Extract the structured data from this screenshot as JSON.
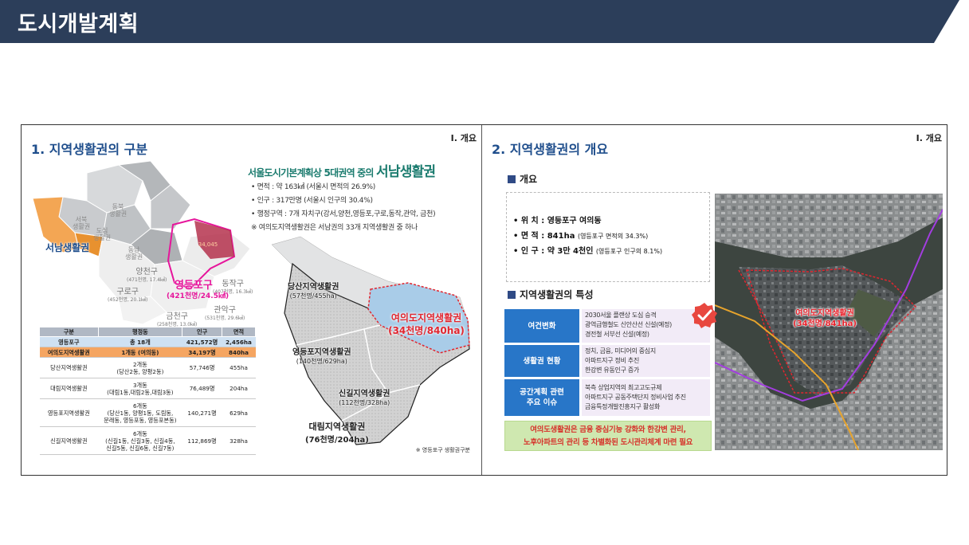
{
  "header": {
    "title": "도시개발계획",
    "color": "#2c3e5a"
  },
  "left_panel": {
    "title": "1. 지역생활권의 구분",
    "section_tag": "Ⅰ. 개요",
    "map_labels": {
      "seonam": "서남생활권",
      "yeongdeungpo": "영등포구",
      "yeongdeungpo_sub": "(421천명/24.5㎢)",
      "yangcheon": "양천구",
      "yangcheon_sub": "(471천명, 17.4㎢)",
      "guro": "구로구",
      "guro_sub": "(452천명, 20.1㎢)",
      "dongjak": "동작구",
      "dongjak_sub": "(407천명, 16.3㎢)",
      "gwanak": "관악구",
      "gwanak_sub": "(531천명, 29.6㎢)",
      "geumcheon": "금천구",
      "geumcheon_sub": "(258천명, 13.0㎢)",
      "dongbuk": "동북\n생활권",
      "seobuk": "서북\n생활권",
      "dosim": "도심\n생활권",
      "dongnam": "동남\n생활권"
    },
    "spatial_title_prefix": "서울도시기본계획상 5대권역 중의 ",
    "spatial_title_big": "서남생활권",
    "bullets": [
      "• 면적 : 약 163㎢ (서울시 면적의 26.9%)",
      "• 인구 : 317만명 (서울시 인구의 30.4%)",
      "• 행정구역 : 7개 자치구(강서,양천,영등포,구로,동작,관악, 금천)",
      "※  여의도지역생활권은 서남권의 33개 지역생활권 중 하나"
    ],
    "table": {
      "headers": [
        "구분",
        "행정동",
        "인구",
        "면적"
      ],
      "rows": [
        {
          "cls": "r-total",
          "cells": [
            "영등포구",
            "총 18개",
            "421,572명",
            "2,456ha"
          ]
        },
        {
          "cls": "r-ydo",
          "cells": [
            "여의도지역생활권",
            "1개동 (여의동)",
            "34,197명",
            "840ha"
          ]
        },
        {
          "cls": "",
          "cells": [
            "당산지역생활권",
            "2개동\n(당산2동, 양평2동)",
            "57,746명",
            "455ha"
          ]
        },
        {
          "cls": "",
          "cells": [
            "대림지역생활권",
            "3개동\n(대림1동,대림2동,대림3동)",
            "76,489명",
            "204ha"
          ]
        },
        {
          "cls": "",
          "cells": [
            "영등포지역생활권",
            "6개동\n(당산1동, 양평1동, 도림동,\n문래동, 영등포동, 영등포본동)",
            "140,271명",
            "629ha"
          ]
        },
        {
          "cls": "",
          "cells": [
            "신길지역생활권",
            "6개동\n(신길1동, 신길3동, 신길4동,\n신길5동, 신길6동, 신길7동)",
            "112,869명",
            "328ha"
          ]
        }
      ]
    },
    "district_labels": {
      "dangsan": "당산지역생활권",
      "dangsan_sub": "(57천명/455ha)",
      "yeouido": "여의도지역생활권",
      "yeouido_sub": "(34천명/840ha)",
      "ydp": "영등포지역생활권",
      "ydp_sub": "(140천명/629ha)",
      "singil": "신길지역생활권",
      "singil_sub": "(112천명/328ha)",
      "daerim": "대림지역생활권",
      "daerim_sub": "(76천명/204ha)"
    },
    "footnote": "※ 영등포구 생활권구분"
  },
  "right_panel": {
    "title": "2. 지역생활권의 개요",
    "section_tag": "Ⅰ. 개요",
    "overview_head": "개요",
    "overview": [
      {
        "main": "• 위  치 : 영등포구 여의동",
        "small": ""
      },
      {
        "main": "• 면  적 : 841ha ",
        "small": "(영등포구 면적의 34.3%)"
      },
      {
        "main": "• 인  구 : 약 3만 4천인 ",
        "small": "(영등포구 인구의 8.1%)"
      }
    ],
    "feature_head": "지역생활권의 특성",
    "features": [
      {
        "head": "여건변화",
        "body": [
          "2030서울 플랜상 도심 승격",
          "광역급행철도 신안산선 신설(예정)",
          "경전철 서부선 신설(예정)"
        ]
      },
      {
        "head": "생활권 현황",
        "body": [
          "정치, 금융, 미디어의 중심지",
          "아파트지구 정비 추진",
          "한강변 유동인구 증가"
        ]
      },
      {
        "head": "공간계획 관련\n주요 이슈",
        "body": [
          "북측 상업지역의 최고고도규제",
          "아파트지구 공동주택단지 정비사업 추진",
          "금융특정개발진흥지구 활성화"
        ]
      }
    ],
    "banner": [
      "여의도생활권은 금융 중심기능 강화와 한강변 관리,",
      "노후아파트의 관리 등 차별화된 도시관리체계 마련 필요"
    ],
    "aerial_label": "여의도지역생활권",
    "aerial_sub": "(34천명/841ha)"
  }
}
